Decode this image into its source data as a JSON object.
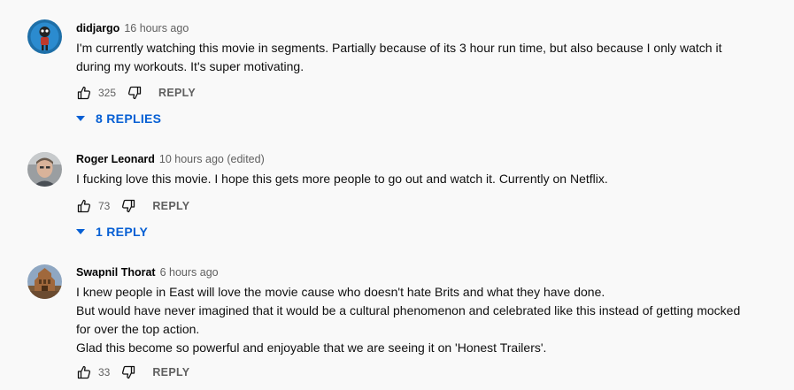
{
  "comments": [
    {
      "author": "didjargo",
      "time": "16 hours ago",
      "text_lines": [
        "I'm currently watching this movie in segments. Partially because of its 3 hour run time, but also because I only watch it",
        "during my workouts. It's super motivating."
      ],
      "likes": "325",
      "reply_label": "REPLY",
      "replies_label": "8 REPLIES"
    },
    {
      "author": "Roger Leonard",
      "time": "10 hours ago (edited)",
      "text_lines": [
        "I fucking love this movie. I hope this gets more people to go out and watch it. Currently on Netflix."
      ],
      "likes": "73",
      "reply_label": "REPLY",
      "replies_label": "1 REPLY"
    },
    {
      "author": "Swapnil Thorat",
      "time": "6 hours ago",
      "text_lines": [
        "I knew people in East will love the movie cause who doesn't hate Brits and what they have done.",
        "But would have never imagined that it would be a cultural phenomenon and celebrated like this instead of getting mocked",
        "for over the top action.",
        "Glad this become so powerful and enjoyable that we are seeing it on 'Honest Trailers'."
      ],
      "likes": "33",
      "reply_label": "REPLY"
    }
  ],
  "icons": {
    "like": "thumbs-up-icon",
    "dislike": "thumbs-down-icon",
    "expand": "caret-down-icon"
  },
  "colors": {
    "background": "#f9f9f9",
    "link_blue": "#065fd4",
    "secondary_text": "#606060"
  }
}
